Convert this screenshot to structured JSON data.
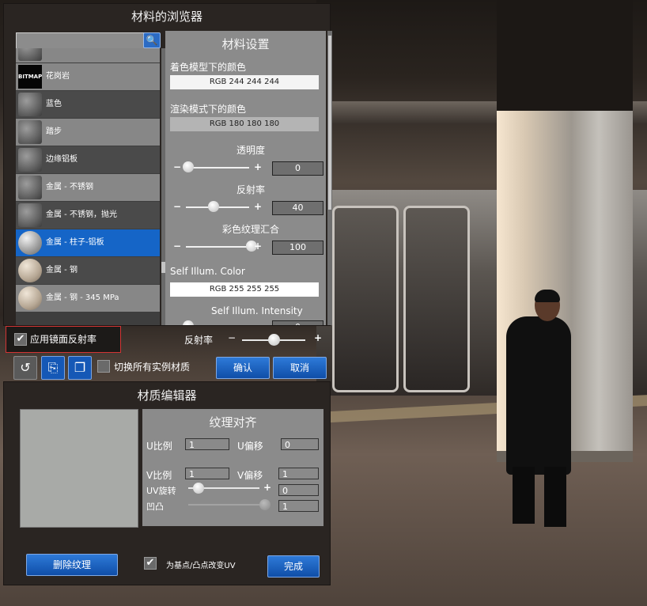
{
  "browser": {
    "title": "材料的浏览器",
    "search": {
      "value": "",
      "placeholder": ""
    },
    "materials": [
      {
        "name": "",
        "thumb": "bitmap"
      },
      {
        "name": "花岗岩",
        "thumb": "BITMAP"
      },
      {
        "name": "蓝色",
        "thumb": "sphere"
      },
      {
        "name": "踏步",
        "thumb": "sphere"
      },
      {
        "name": "边缘铝板",
        "thumb": "sphere"
      },
      {
        "name": "金属 - 不锈钢",
        "thumb": "sphere"
      },
      {
        "name": "金属 - 不锈钢，抛光",
        "thumb": "sphere"
      },
      {
        "name": "金属 - 柱子-铝板",
        "thumb": "ball"
      },
      {
        "name": "金属 - 钢",
        "thumb": "stone"
      },
      {
        "name": "金属 - 钢 - 345 MPa",
        "thumb": "stone"
      }
    ]
  },
  "settings": {
    "title": "材料设置",
    "shading_color_label": "着色模型下的颜色",
    "shading_color_value": "RGB 244 244 244",
    "shading_color_hex": "#f4f4f4",
    "render_color_label": "渲染模式下的颜色",
    "render_color_value": "RGB 180 180 180",
    "render_color_hex": "#b4b4b4",
    "transparency_label": "透明度",
    "transparency_value": "0",
    "reflectivity_label": "反射率",
    "reflectivity_value": "40",
    "texture_blend_label": "彩色纹理汇合",
    "texture_blend_value": "100",
    "self_illum_color_label": "Self Illum. Color",
    "self_illum_color_value": "RGB 255 255 255",
    "self_illum_color_hex": "#ffffff",
    "self_illum_intensity_label": "Self Illum. Intensity",
    "self_illum_intensity_value": "0"
  },
  "bottom": {
    "mirror_label": "应用镜面反射率",
    "mirror_checked": true,
    "reflect_label": "反射率",
    "switch_label": "切换所有实例材质",
    "confirm_label": "确认",
    "cancel_label": "取消"
  },
  "editor": {
    "title": "材质编辑器",
    "align_title": "纹理对齐",
    "u_scale_label": "U比例",
    "u_scale_value": "1",
    "u_offset_label": "U偏移",
    "u_offset_value": "0",
    "v_scale_label": "V比例",
    "v_scale_value": "1",
    "v_offset_label": "V偏移",
    "v_offset_value": "1",
    "uv_rotate_label": "UV旋转",
    "uv_rotate_value": "0",
    "bump_label": "凹凸",
    "bump_value": "1",
    "delete_texture_label": "删除纹理",
    "change_uv_label": "为基点/凸点改变UV",
    "done_label": "完成"
  },
  "colors": {
    "selected_item": "#1565c7",
    "button_blue": "#1f66c4",
    "highlight_border": "#d23434"
  }
}
